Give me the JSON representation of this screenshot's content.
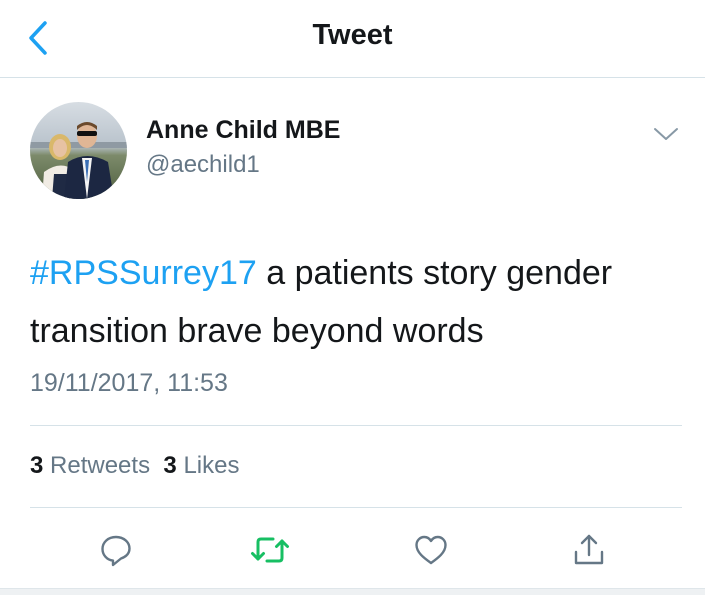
{
  "header": {
    "title": "Tweet",
    "back_icon": "chevron-left-icon"
  },
  "tweet": {
    "author": {
      "display_name": "Anne Child MBE",
      "handle": "@aechild1"
    },
    "hashtag": "#RPSSurrey17",
    "text": " a patients story gender transition brave beyond words",
    "timestamp": "19/11/2017, 11:53",
    "stats": {
      "retweets_count": "3",
      "retweets_label": "Retweets",
      "likes_count": "3",
      "likes_label": "Likes"
    }
  },
  "actions": [
    {
      "name": "reply",
      "icon": "reply-icon"
    },
    {
      "name": "retweet",
      "icon": "retweet-icon"
    },
    {
      "name": "like",
      "icon": "heart-icon"
    },
    {
      "name": "share",
      "icon": "share-icon"
    }
  ],
  "colors": {
    "accent": "#1da1f2",
    "retweet": "#17bf63",
    "secondary_text": "#657786",
    "divider": "#d6e2e8"
  }
}
